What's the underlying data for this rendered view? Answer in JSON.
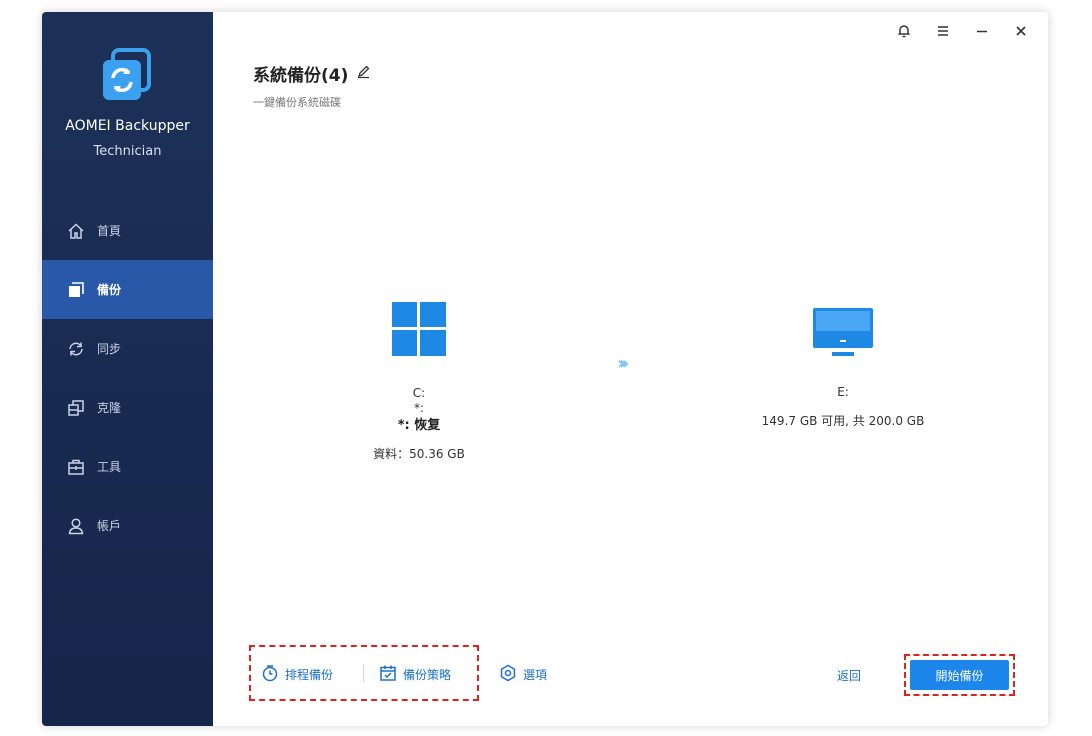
{
  "app": {
    "name": "AOMEI Backupper",
    "edition": "Technician"
  },
  "nav": {
    "items": [
      {
        "label": "首頁",
        "icon": "home-icon",
        "active": false
      },
      {
        "label": "備份",
        "icon": "backup-icon",
        "active": true
      },
      {
        "label": "同步",
        "icon": "sync-icon",
        "active": false
      },
      {
        "label": "克隆",
        "icon": "clone-icon",
        "active": false
      },
      {
        "label": "工具",
        "icon": "tools-icon",
        "active": false
      },
      {
        "label": "帳戶",
        "icon": "account-icon",
        "active": false
      }
    ]
  },
  "page": {
    "title": "系統備份(4)",
    "subtitle": "一鍵備份系統磁碟"
  },
  "source": {
    "drive": "C:",
    "line2": "*:",
    "line3": "*: 恢复",
    "data": "資料：50.36 GB",
    "icon": "windows-logo-icon"
  },
  "destination": {
    "drive": "E:",
    "capacity": "149.7 GB 可用, 共 200.0 GB",
    "icon": "monitor-icon"
  },
  "footer": {
    "schedule_label": "排程備份",
    "scheme_label": "備份策略",
    "options_label": "選項",
    "back_label": "返回",
    "start_label": "開始備份"
  },
  "colors": {
    "sidebar": "#1d3158",
    "active_nav": "#2a58a8",
    "accent": "#1d86ea",
    "link": "#1a6fd0",
    "highlight": "#e0221e"
  }
}
